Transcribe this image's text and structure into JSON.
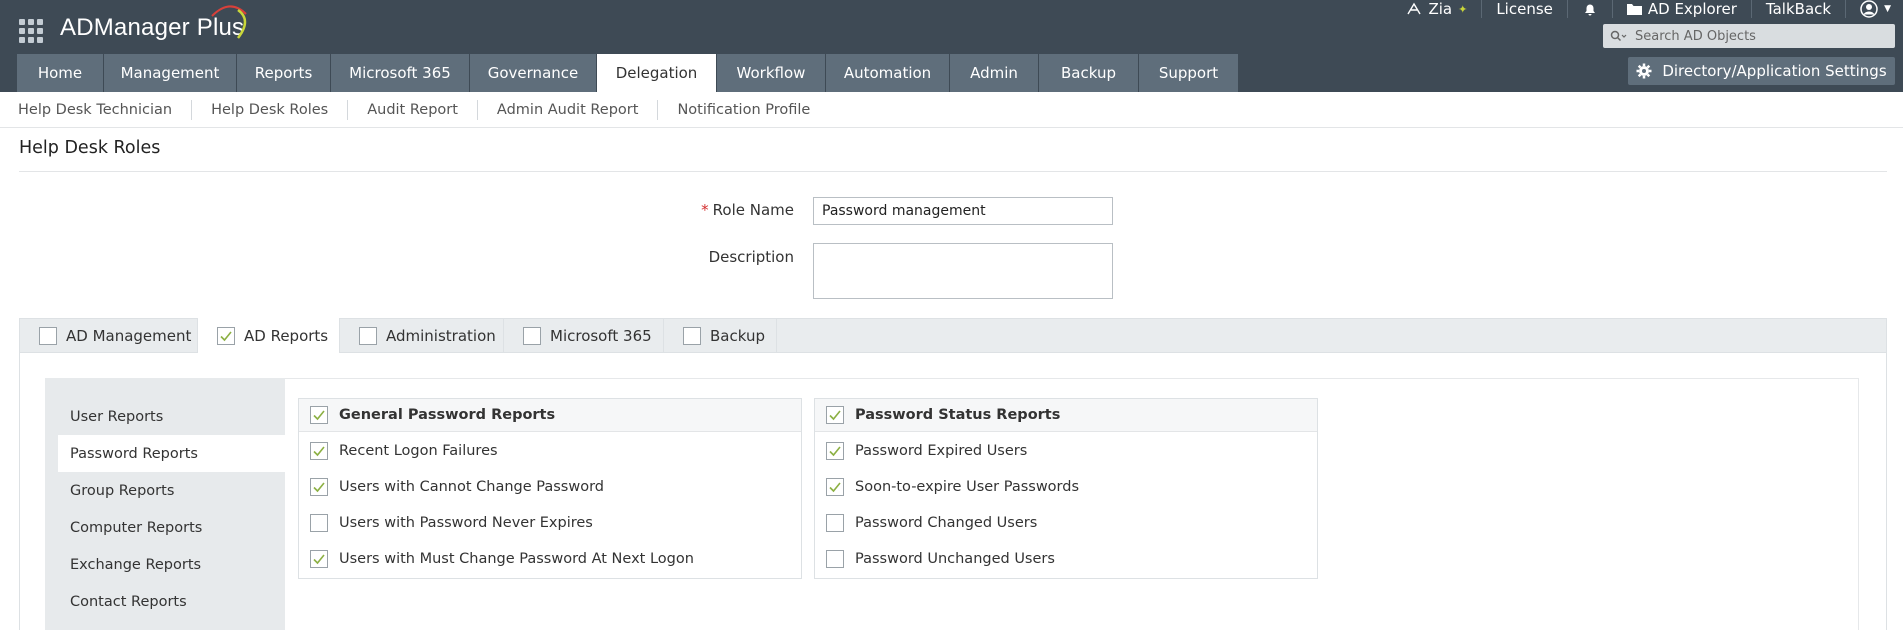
{
  "app": {
    "name": "ADManager Plus",
    "top_links": {
      "zia": "Zia",
      "license": "License",
      "ad_explorer": "AD Explorer",
      "talkback": "TalkBack"
    },
    "search_placeholder": "Search AD Objects",
    "settings_label": "Directory/Application Settings",
    "accent_color": "#8cb043"
  },
  "tabs": [
    {
      "label": "Home",
      "active": false
    },
    {
      "label": "Management",
      "active": false
    },
    {
      "label": "Reports",
      "active": false
    },
    {
      "label": "Microsoft 365",
      "active": false
    },
    {
      "label": "Governance",
      "active": false
    },
    {
      "label": "Delegation",
      "active": true
    },
    {
      "label": "Workflow",
      "active": false
    },
    {
      "label": "Automation",
      "active": false
    },
    {
      "label": "Admin",
      "active": false
    },
    {
      "label": "Backup",
      "active": false
    },
    {
      "label": "Support",
      "active": false
    }
  ],
  "subnav": [
    "Help Desk Technician",
    "Help Desk Roles",
    "Audit Report",
    "Admin Audit Report",
    "Notification Profile"
  ],
  "page": {
    "title": "Help Desk Roles"
  },
  "form": {
    "role_name_label": "Role Name",
    "role_name_value": "Password management",
    "description_label": "Description",
    "description_value": ""
  },
  "modules": [
    {
      "label": "AD Management",
      "checked": false,
      "active": false
    },
    {
      "label": "AD Reports",
      "checked": true,
      "active": true
    },
    {
      "label": "Administration",
      "checked": false,
      "active": false
    },
    {
      "label": "Microsoft 365",
      "checked": false,
      "active": false
    },
    {
      "label": "Backup",
      "checked": false,
      "active": false
    }
  ],
  "report_categories": [
    {
      "label": "User Reports",
      "active": false
    },
    {
      "label": "Password Reports",
      "active": true
    },
    {
      "label": "Group Reports",
      "active": false
    },
    {
      "label": "Computer Reports",
      "active": false
    },
    {
      "label": "Exchange Reports",
      "active": false
    },
    {
      "label": "Contact Reports",
      "active": false
    }
  ],
  "panels": [
    {
      "title": "General Password Reports",
      "checked": true,
      "items": [
        {
          "label": "Recent Logon Failures",
          "checked": true
        },
        {
          "label": "Users with Cannot Change Password",
          "checked": true
        },
        {
          "label": "Users with Password Never Expires",
          "checked": false
        },
        {
          "label": "Users with Must Change Password At Next Logon",
          "checked": true
        }
      ]
    },
    {
      "title": "Password Status Reports",
      "checked": true,
      "items": [
        {
          "label": "Password Expired Users",
          "checked": true
        },
        {
          "label": "Soon-to-expire User Passwords",
          "checked": true
        },
        {
          "label": "Password Changed Users",
          "checked": false
        },
        {
          "label": "Password Unchanged Users",
          "checked": false
        }
      ]
    }
  ]
}
